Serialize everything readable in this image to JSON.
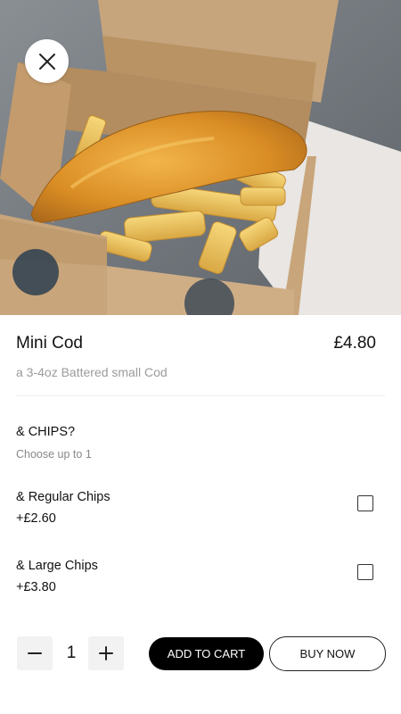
{
  "item": {
    "image_alt": "Battered cod and chips in a cardboard box",
    "title": "Mini Cod",
    "price": "£4.80",
    "description": "a 3-4oz Battered small Cod"
  },
  "modifier_group": {
    "title": "& CHIPS?",
    "hint": "Choose up to 1",
    "options": [
      {
        "label": "& Regular Chips",
        "price": "+£2.60"
      },
      {
        "label": "& Large Chips",
        "price": "+£3.80"
      }
    ]
  },
  "quantity": "1",
  "actions": {
    "add_to_cart": "ADD TO CART",
    "buy_now": "BUY NOW"
  },
  "icons": {
    "close": "close-icon",
    "minus": "minus-icon",
    "plus": "plus-icon"
  },
  "colors": {
    "primary_button": "#000000",
    "muted_text": "#9b9b9b"
  }
}
